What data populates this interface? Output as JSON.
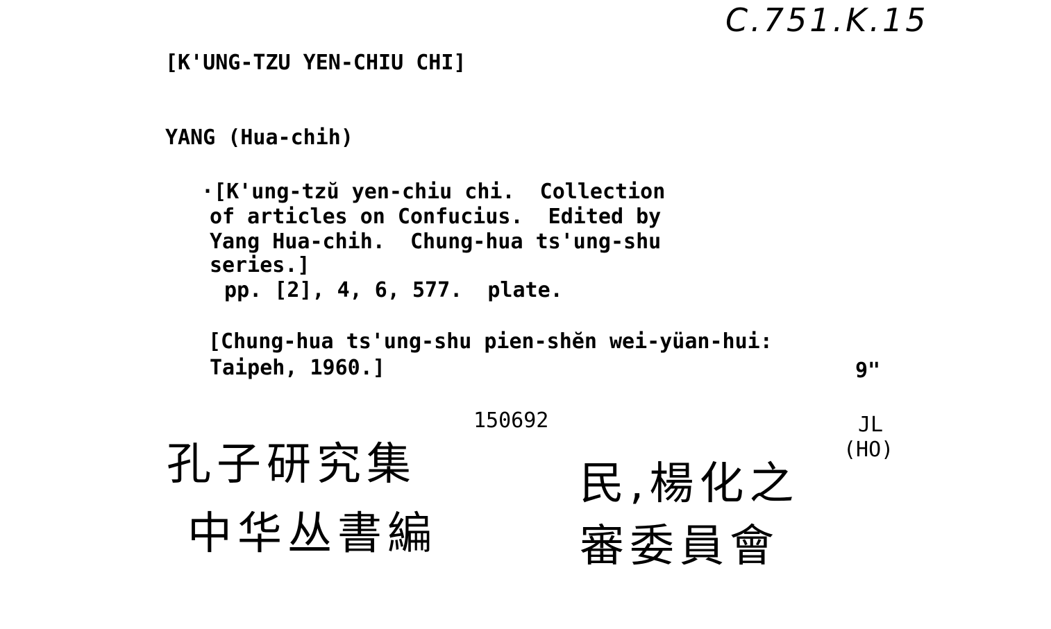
{
  "call_number": "C.751.K.15",
  "title_heading": "[K'UNG-TZU YEN-CHIU CHI]",
  "author_heading": "YANG (Hua-chih)",
  "description_lines": [
    "·[K'ung-tzŭ yen-chiu chi.  Collection",
    "of articles on Confucius.  Edited by",
    "Yang Hua-chih.  Chung-hua ts'ung-shu",
    "series.]",
    " pp. [2], 4, 6, 577.  plate."
  ],
  "imprint_lines": [
    "[Chung-hua ts'ung-shu pien-shĕn wei-yüan-hui:",
    "Taipeh, 1960.]"
  ],
  "size": "9\"",
  "accession_number": "150692",
  "initials": "JL",
  "initials_sub": "(HO)",
  "chinese_title": "孔子研究集",
  "chinese_author": "民,楊化之",
  "chinese_publisher_1": "中华丛書編",
  "chinese_publisher_2": "審委員會"
}
